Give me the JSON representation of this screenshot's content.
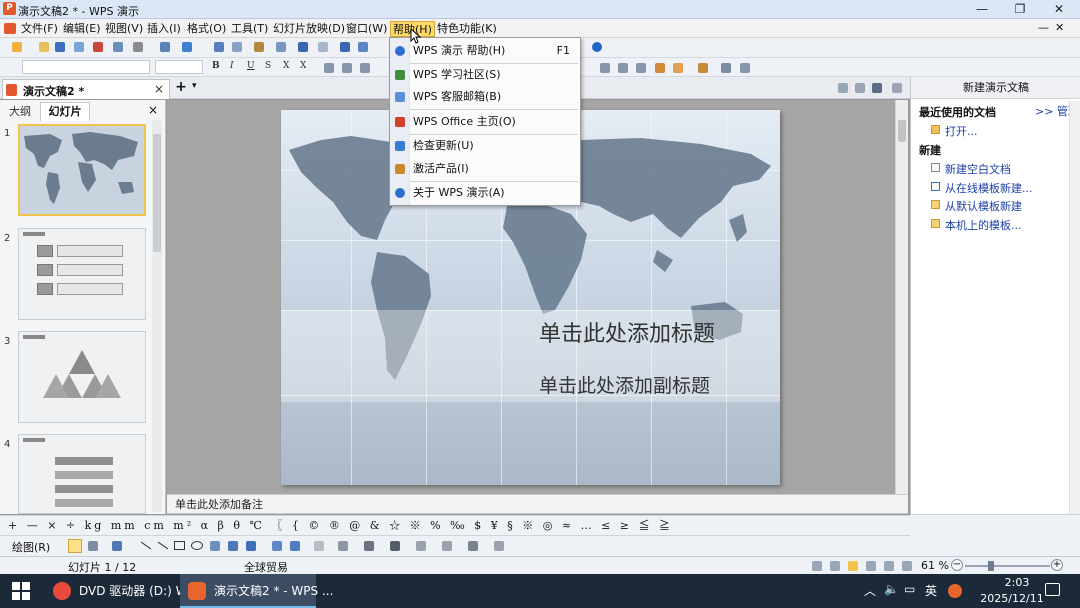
{
  "window": {
    "title": "演示文稿2 * - WPS 演示",
    "app_icon": "wps-presentation-icon"
  },
  "menubar": [
    "文件(F)",
    "编辑(E)",
    "视图(V)",
    "插入(I)",
    "格式(O)",
    "工具(T)",
    "幻灯片放映(D)",
    "窗口(W)",
    "帮助(H)",
    "特色功能(K)"
  ],
  "help_menu": [
    {
      "label": "WPS 演示 帮助(H)",
      "shortcut": "F1",
      "icon": "help-icon",
      "color": "#2f6fd1"
    },
    {
      "label": "WPS 学习社区(S)",
      "shortcut": "",
      "icon": "community-icon",
      "color": "#3f8f3f"
    },
    {
      "label": "WPS 客服邮箱(B)",
      "shortcut": "",
      "icon": "mail-icon",
      "color": "#5a8fd8"
    },
    {
      "label": "WPS Office 主页(O)",
      "shortcut": "",
      "icon": "home-icon",
      "color": "#d0402b"
    },
    {
      "label": "检查更新(U)",
      "shortcut": "",
      "icon": "update-icon",
      "color": "#3a7bd5"
    },
    {
      "label": "激活产品(I)",
      "shortcut": "",
      "icon": "key-icon",
      "color": "#c98a2b"
    },
    {
      "label": "关于 WPS 演示(A)",
      "shortcut": "",
      "icon": "about-icon",
      "color": "#2f6fd1"
    }
  ],
  "doc_tab": {
    "title": "演示文稿2 *"
  },
  "left_pane": {
    "tab_outline": "大纲",
    "tab_slides": "幻灯片",
    "thumbs": [
      "1",
      "2",
      "3",
      "4"
    ]
  },
  "slide": {
    "title_placeholder": "单击此处添加标题",
    "subtitle_placeholder": "单击此处添加副标题"
  },
  "notes": {
    "placeholder": "单击此处添加备注"
  },
  "task_pane": {
    "header": "新建演示文稿",
    "recent_title": "最近使用的文档",
    "manage": ">> 管理",
    "open": "打开...",
    "new_title": "新建",
    "new_links": [
      "新建空白文档",
      "从在线模板新建...",
      "从默认模板新建",
      "本机上的模板..."
    ]
  },
  "symbol_bar": "+ — × ÷ kg mm cm m² α β θ ℃ 〖 { © ® @ & ☆ ※ % ‰ $ ¥ § ※ ◎ ≈ … ≤ ≥ ≦ ≧",
  "draw_bar": {
    "label": "绘图(R)"
  },
  "status": {
    "slide": "幻灯片 1 / 12",
    "theme": "全球贸易",
    "zoom": "61 %",
    "zoom_fraction": 0.3
  },
  "taskbar": {
    "items": [
      {
        "label": "DVD 驱动器 (D:) W...",
        "color": "#e84b3c"
      },
      {
        "label": "演示文稿2 * - WPS ...",
        "color": "#e8662e"
      }
    ],
    "ime": "英",
    "time": "2:03",
    "date": "2025/12/11"
  }
}
